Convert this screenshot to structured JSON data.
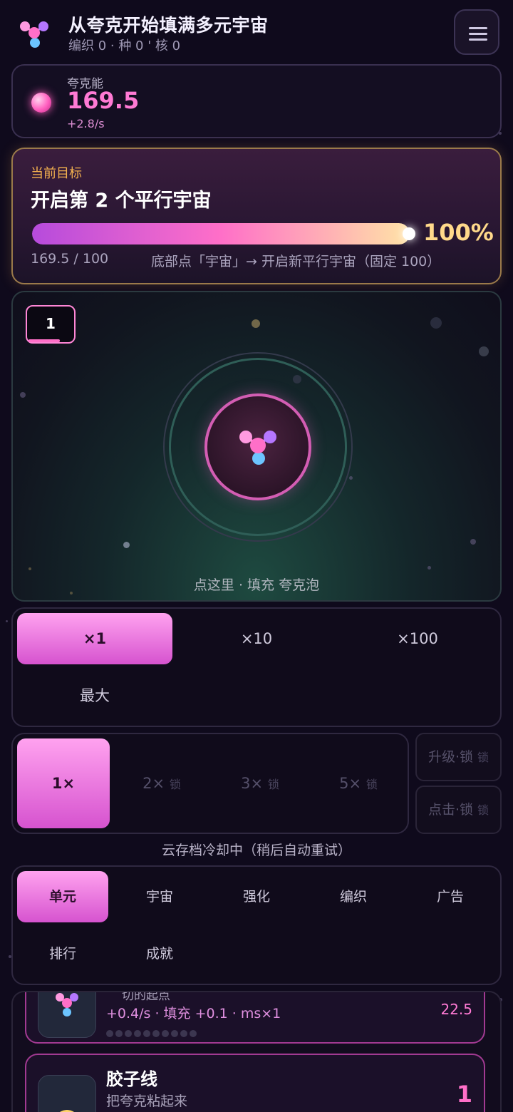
{
  "header": {
    "title": "从夸克开始填满多元宇宙",
    "subtitle": "编织 0 · 种 0 ' 核 0",
    "logo_icon": "quark-molecule-icon",
    "menu_icon": "hamburger-menu-icon"
  },
  "energy": {
    "label": "夸克能",
    "value": "169.5",
    "rate": "+2.8/s",
    "icon": "pink-orb-icon"
  },
  "goal": {
    "label": "当前目标",
    "heading": "开启第 2 个平行宇宙",
    "progress_percent": 100,
    "percent_text": "100%",
    "ratio": "169.5 / 100",
    "hint": "底部点「宇宙」→ 开启新平行宇宙（固定 100）"
  },
  "arena": {
    "universe_number": "1",
    "tap_hint": "点这里 · 填充 夸克泡",
    "core_icon": "quark-molecule-icon"
  },
  "multiplier": {
    "options": [
      "×1",
      "×10",
      "×100",
      "最大"
    ],
    "selected": "×1"
  },
  "speed": {
    "options": [
      {
        "label": "1×",
        "lock": ""
      },
      {
        "label": "2×",
        "lock": "锁"
      },
      {
        "label": "3×",
        "lock": "锁"
      },
      {
        "label": "5×",
        "lock": "锁"
      }
    ],
    "selected": "1×",
    "side_buttons": [
      {
        "label": "升级·锁",
        "lock": "锁"
      },
      {
        "label": "点击·锁",
        "lock": "锁"
      }
    ]
  },
  "cloud_status": "云存档冷却中（稍后自动重试）",
  "tabs": {
    "items": [
      "单元",
      "宇宙",
      "强化",
      "编织",
      "广告",
      "排行",
      "成就"
    ],
    "selected": "单元"
  },
  "units": [
    {
      "name": "",
      "desc": "切的起点",
      "stats": "+0.4/s · 填充 +0.1 · ms×1",
      "count": "22.5"
    },
    {
      "name": "胶子线",
      "desc": "把夸克粘起来",
      "level": "1"
    }
  ],
  "colors": {
    "accent_pink": "#ff6fc8",
    "goal_gold": "#f2b04f",
    "percent_gold": "#ffd98a",
    "background": "#0f0a1c"
  }
}
